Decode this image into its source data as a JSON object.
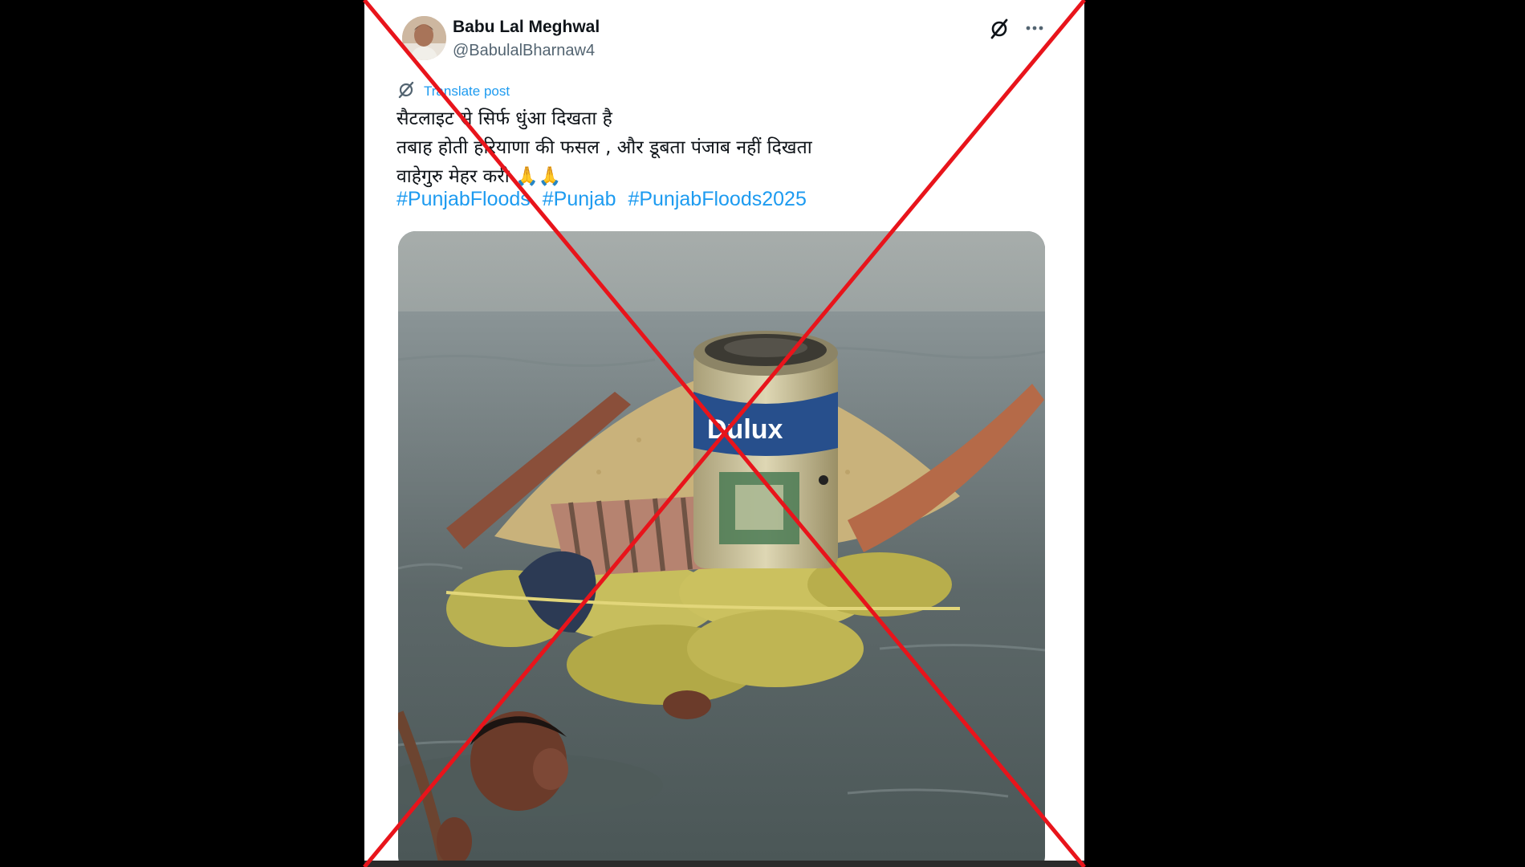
{
  "post": {
    "author_name": "Babu Lal Meghwal",
    "author_handle": "@BabulalBharnaw4",
    "translate_label": "Translate post",
    "text_lines": [
      "सैटलाइट से सिर्फ धुंआ दिखता है",
      "तबाह होती हरियाणा की फसल , और डूबता पंजाब नहीं दिखता",
      "वाहेगुरु मेहर करी 🙏🙏"
    ],
    "hashtags": [
      "#PunjabFloods",
      "#Punjab",
      "#PunjabFloods2025"
    ],
    "media_logo_text": "Dulux"
  },
  "icons": {
    "grok": "grok-icon",
    "more": "more-options-icon",
    "translate": "translate-icon"
  },
  "colors": {
    "link": "#1d9bf0",
    "text": "#0f1419",
    "secondary": "#536471",
    "cross": "#e8141b"
  }
}
